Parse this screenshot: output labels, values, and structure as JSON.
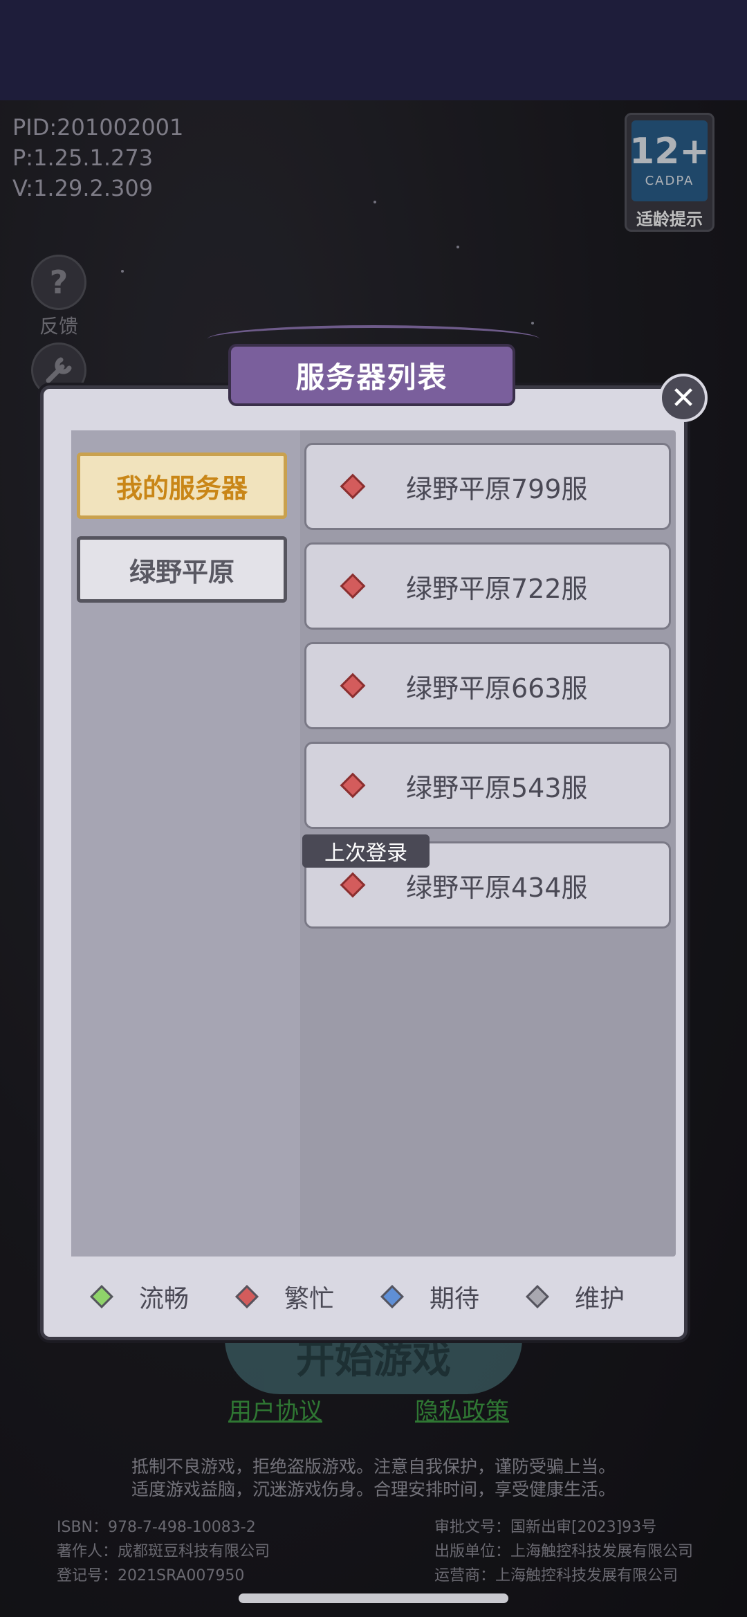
{
  "build_info": {
    "pid": "PID:201002001",
    "p": "P:1.25.1.273",
    "v": "V:1.29.2.309"
  },
  "age_badge": {
    "rating": "12+",
    "org": "CADPA",
    "label": "适龄提示"
  },
  "side_menu": {
    "feedback_label": "反馈",
    "feedback_glyph": "?"
  },
  "dialog": {
    "title": "服务器列表",
    "close_glyph": "✕",
    "categories": [
      {
        "label": "我的服务器",
        "selected": true
      },
      {
        "label": "绿野平原",
        "selected": false
      }
    ],
    "servers": [
      {
        "name": "绿野平原799服",
        "status": "繁忙"
      },
      {
        "name": "绿野平原722服",
        "status": "繁忙"
      },
      {
        "name": "绿野平原663服",
        "status": "繁忙"
      },
      {
        "name": "绿野平原543服",
        "status": "繁忙"
      },
      {
        "name": "绿野平原434服",
        "status": "繁忙"
      }
    ],
    "last_login_tag": "上次登录",
    "legend": [
      {
        "label": "流畅",
        "color": "#8fd36a"
      },
      {
        "label": "繁忙",
        "color": "#d35c5c"
      },
      {
        "label": "期待",
        "color": "#5f8fd6"
      },
      {
        "label": "维护",
        "color": "#a9a8b0"
      }
    ]
  },
  "bottom": {
    "start_button": "开始游戏",
    "user_agreement": "用户协议",
    "privacy_policy": "隐私政策",
    "notice_line1": "抵制不良游戏，拒绝盗版游戏。注意自我保护，谨防受骗上当。",
    "notice_line2": "适度游戏益脑，沉迷游戏伤身。合理安排时间，享受健康生活。",
    "isbn": "ISBN：978-7-498-10083-2",
    "author": "著作人：成都斑豆科技有限公司",
    "reg": "登记号：2021SRA007950",
    "approval": "审批文号：国新出审[2023]93号",
    "publisher": "出版单位：上海触控科技发展有限公司",
    "operator": "运营商：上海触控科技发展有限公司"
  }
}
